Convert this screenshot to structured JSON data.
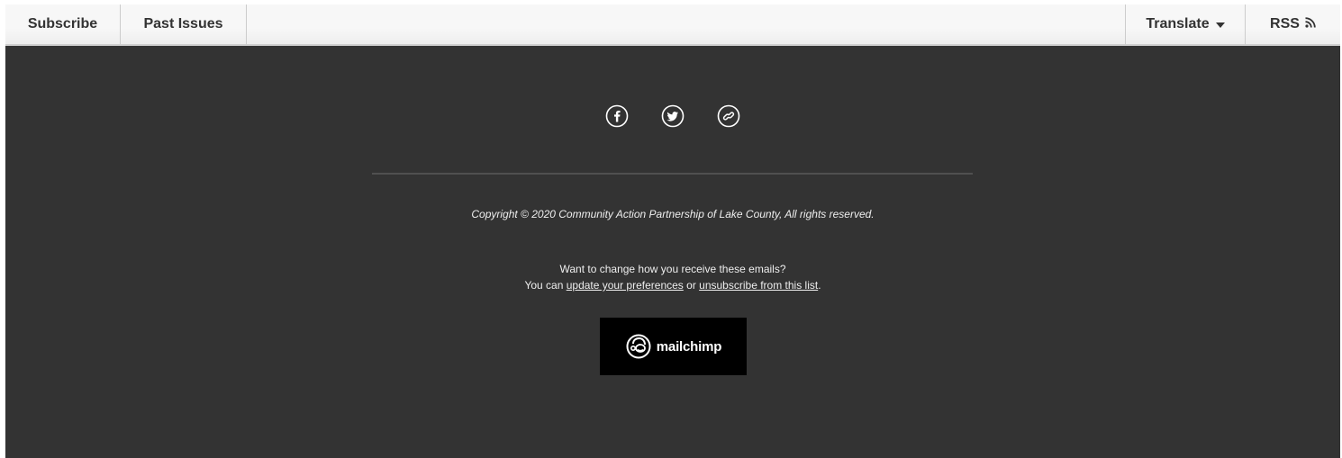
{
  "nav": {
    "subscribe": "Subscribe",
    "past_issues": "Past Issues",
    "translate": "Translate",
    "rss": "RSS"
  },
  "social": [
    {
      "icon": "facebook-icon"
    },
    {
      "icon": "twitter-icon"
    },
    {
      "icon": "link-icon"
    }
  ],
  "footer": {
    "copyright": "Copyright © 2020 Community Action Partnership of Lake County, All rights reserved.",
    "prefs_question": "Want to change how you receive these emails?",
    "prefs_prefix": "You can ",
    "prefs_update_link": "update your preferences",
    "prefs_or": " or ",
    "prefs_unsub_link": "unsubscribe from this list",
    "prefs_suffix": ".",
    "badge_text": "mailchimp"
  },
  "colors": {
    "background": "#333333",
    "topbar": "#f3f3f3",
    "text": "#eeeeee",
    "badge": "#000000"
  }
}
